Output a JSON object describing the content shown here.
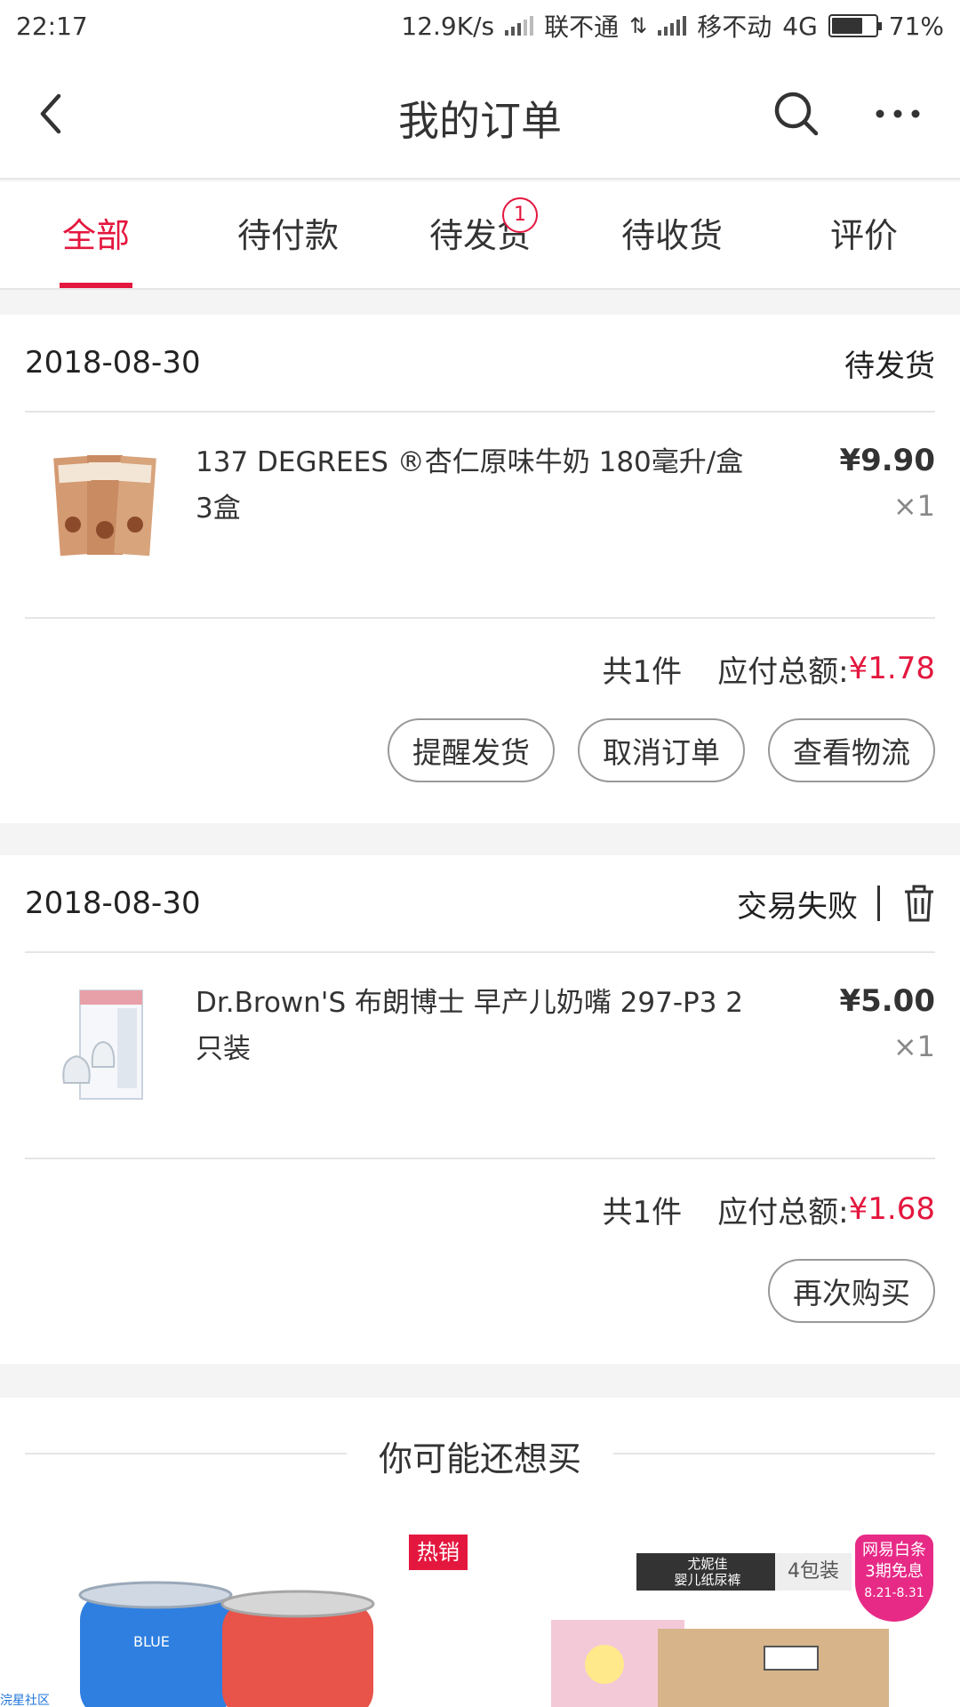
{
  "status_bar": {
    "time": "22:17",
    "speed": "12.9K/s",
    "carrier1": "联不通",
    "carrier2": "移不动",
    "network": "4G",
    "battery": "71%",
    "battery_level": 0.71
  },
  "nav": {
    "title": "我的订单",
    "back_icon": "chevron-left-icon",
    "search_icon": "search-icon",
    "more_icon": "more-icon"
  },
  "tabs": [
    {
      "label": "全部",
      "active": true
    },
    {
      "label": "待付款",
      "active": false
    },
    {
      "label": "待发货",
      "active": false,
      "badge": "1"
    },
    {
      "label": "待收货",
      "active": false
    },
    {
      "label": "评价",
      "active": false
    }
  ],
  "orders": [
    {
      "date": "2018-08-30",
      "status": "待发货",
      "product": {
        "name": "137 DEGREES ®杏仁原味牛奶 180毫升/盒 3盒",
        "price": "¥9.90",
        "qty": "×1"
      },
      "count": "共1件",
      "total_label": "应付总额:",
      "total": "¥1.78",
      "actions": [
        "提醒发货",
        "取消订单",
        "查看物流"
      ]
    },
    {
      "date": "2018-08-30",
      "status": "交易失败",
      "product": {
        "name": "Dr.Brown'S 布朗博士 早产儿奶嘴 297-P3 2只装",
        "price": "¥5.00",
        "qty": "×1"
      },
      "count": "共1件",
      "total_label": "应付总额:",
      "total": "¥1.68",
      "actions": [
        "再次购买"
      ]
    }
  ],
  "recommend": {
    "title": "你可能还想买",
    "hot_tag": "热销",
    "brand_chip_line1": "尤妮佳",
    "brand_chip_line2": "婴儿纸尿裤",
    "pack_label": "4包装",
    "promo_line1": "网易白条",
    "promo_line2": "3期免息",
    "promo_line3": "8.21-8.31",
    "link": "浣星社区"
  },
  "colors": {
    "accent": "#e4173e",
    "promo": "#e72a86"
  }
}
